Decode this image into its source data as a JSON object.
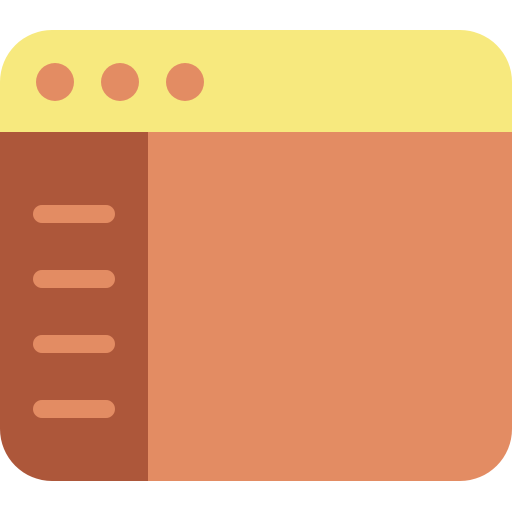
{
  "colors": {
    "titlebar": "#F7E97E",
    "window_dot": "#E38C63",
    "sidebar": "#AD573A",
    "sidebar_line": "#E38C63",
    "content": "#E38C63"
  },
  "titlebar": {
    "dots": [
      "window-dot",
      "window-dot",
      "window-dot"
    ]
  },
  "sidebar": {
    "items": [
      "placeholder-line",
      "placeholder-line",
      "placeholder-line",
      "placeholder-line"
    ]
  }
}
